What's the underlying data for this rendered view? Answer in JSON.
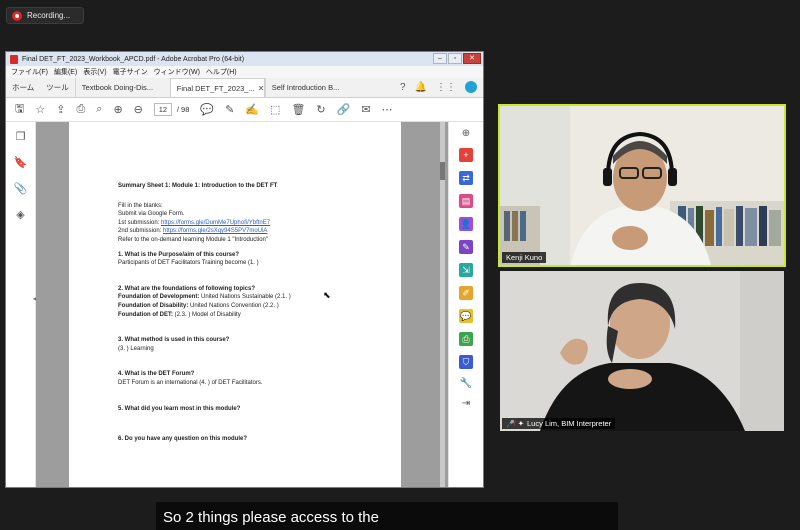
{
  "recording": {
    "label": "Recording..."
  },
  "acrobat": {
    "title": "Final DET_FT_2023_Workbook_APCD.pdf - Adobe Acrobat Pro (64-bit)",
    "menu": [
      "ファイル(F)",
      "編集(E)",
      "表示(V)",
      "電子サイン",
      "ウィンドウ(W)",
      "ヘルプ(H)"
    ],
    "tabs": {
      "home": "ホーム",
      "tools": "ツール",
      "doc1": "Textbook Doing-Dis...",
      "doc2": "Final DET_FT_2023_...",
      "doc3": "Self Introduction B..."
    },
    "toolbar": {
      "current_page": "12",
      "total_pages": "/ 98"
    },
    "page": {
      "heading": "Summary Sheet 1: Module 1: Introduction to the DET FT",
      "fill": "Fill in the blanks:",
      "submit": "Submit via Google Form.",
      "sub1_prefix": "1st submission: ",
      "sub1_link": "https://forms.gle/DumMe7Uphofi/YbftnE7",
      "sub2_prefix": "2nd submission: ",
      "sub2_link": "https://forms.gle/2sXqy94S5PV7moUiA",
      "refer": "Refer to the on-demand learning Module 1 \"Introduction\"",
      "q1": "1. What is the Purpose/aim of this course?",
      "a1": "Participants of DET Facilitators Training become (1.                    )",
      "q2": "2. What are the foundations of following topics?",
      "a2_dev_label": "Foundation of Development:",
      "a2_dev": " United Nations Sustainable (2.1.                                  )",
      "a2_dis_label": "Foundation of Disability:",
      "a2_dis": " United Nations Convention (2.2.                                    )",
      "a2_det_label": "Foundation of DET:",
      "a2_det": " (2.3.                ) Model of Disability",
      "q3": "3. What method is used in this course?",
      "a3": "(3.                  ) Learning",
      "q4": "4. What is the DET Forum?",
      "a4": "DET Forum is an international (4.                  ) of DET Facilitators.",
      "q5": "5. What did you learn most in this module?",
      "q6": "6. Do you have any question on this module?"
    }
  },
  "participants": {
    "p1": {
      "name": "Kenji Kuno"
    },
    "p2": {
      "name": "Lucy Lim, BIM Interpreter"
    }
  },
  "caption": {
    "text": "So 2 things please access to the"
  },
  "colors": {
    "active_speaker": "#c8e82a",
    "recording": "#e02424"
  }
}
